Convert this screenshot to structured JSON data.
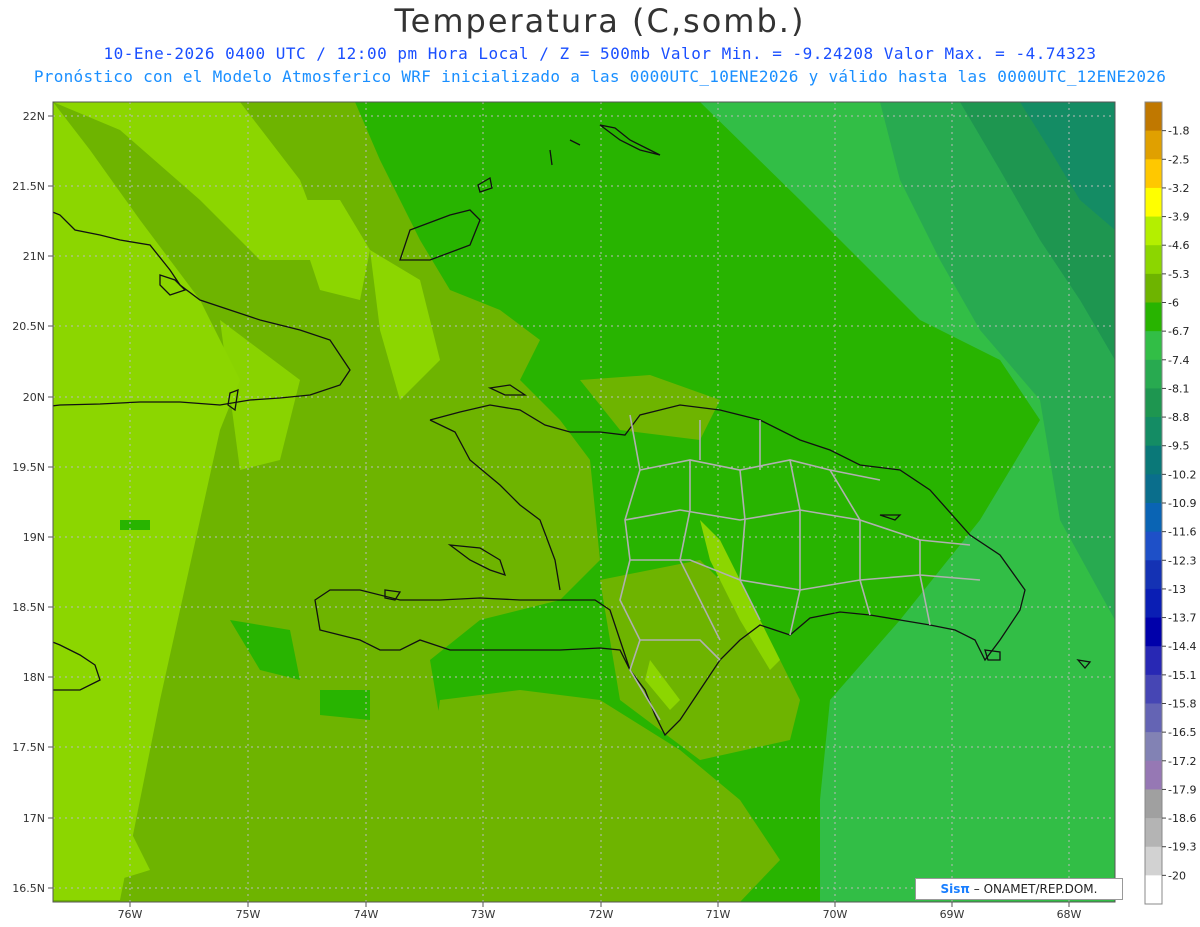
{
  "header": {
    "title": "Temperatura (C,somb.)",
    "subtitle1": "10-Ene-2026  0400 UTC / 12:00 pm Hora Local / Z = 500mb  Valor Min. = -9.24208  Valor Max. = -4.74323",
    "subtitle2": "Pronóstico con el Modelo Atmosferico WRF inicializado a las 0000UTC_10ENE2026 y válido hasta las  0000UTC_12ENE2026"
  },
  "axes": {
    "lat_labels": [
      "22N",
      "21.5N",
      "21N",
      "20.5N",
      "20N",
      "19.5N",
      "19N",
      "18.5N",
      "18N",
      "17.5N",
      "17N",
      "16.5N"
    ],
    "lat_values": [
      22,
      21.5,
      21,
      20.5,
      20,
      19.5,
      19,
      18.5,
      18,
      17.5,
      17,
      16.5
    ],
    "lon_labels": [
      "76W",
      "75W",
      "74W",
      "73W",
      "72W",
      "71W",
      "70W",
      "69W",
      "68W"
    ],
    "lon_values": [
      -76,
      -75,
      -74,
      -73,
      -72,
      -71,
      -70,
      -69,
      -68
    ],
    "lon_range": [
      -76.65,
      -67.6
    ],
    "lat_range": [
      16.4,
      22.1
    ]
  },
  "colorbar": {
    "labels": [
      "-1.8",
      "-2.5",
      "-3.2",
      "-3.9",
      "-4.6",
      "-5.3",
      "-6",
      "-6.7",
      "-7.4",
      "-8.1",
      "-8.8",
      "-9.5",
      "-10.2",
      "-10.9",
      "-11.6",
      "-12.3",
      "-13",
      "-13.7",
      "-14.4",
      "-15.1",
      "-15.8",
      "-16.5",
      "-17.2",
      "-17.9",
      "-18.6",
      "-19.3",
      "-20"
    ],
    "colors": [
      "#c07800",
      "#e0a000",
      "#ffc800",
      "#ffff00",
      "#b4ef00",
      "#8cd600",
      "#6eb400",
      "#28b400",
      "#32be46",
      "#28aa50",
      "#1e9650",
      "#148c64",
      "#0a7878",
      "#0a6e8c",
      "#0a64b4",
      "#1e50c8",
      "#1432b4",
      "#0a1eb4",
      "#0000aa",
      "#2828b4",
      "#4646b4",
      "#6464b4",
      "#8282b4",
      "#9678b4",
      "#a0a0a0",
      "#b4b4b4",
      "#d2d2d2",
      "#ffffff"
    ]
  },
  "credit": {
    "brand": "Sisπ",
    "text": "– ONAMET/REP.DOM."
  }
}
